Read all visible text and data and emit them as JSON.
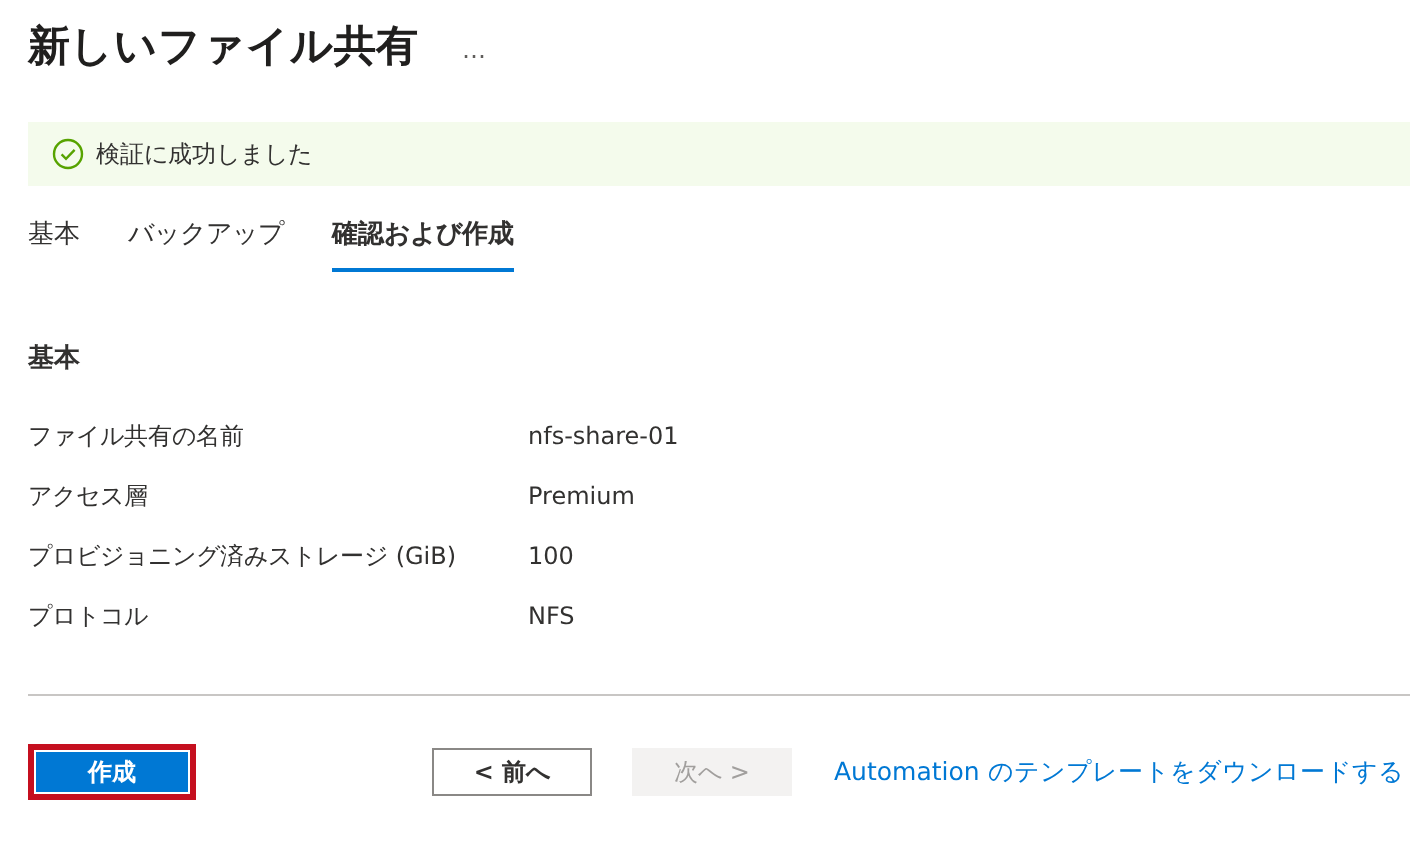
{
  "title": "新しいファイル共有",
  "more": "…",
  "banner": {
    "text": "検証に成功しました"
  },
  "tabs": [
    {
      "label": "基本",
      "selected": false
    },
    {
      "label": "バックアップ",
      "selected": false
    },
    {
      "label": "確認および作成",
      "selected": true
    }
  ],
  "section": "基本",
  "rows": [
    {
      "label": "ファイル共有の名前",
      "value": "nfs-share-01"
    },
    {
      "label": "アクセス層",
      "value": "Premium"
    },
    {
      "label": "プロビジョニング済みストレージ (GiB)",
      "value": "100"
    },
    {
      "label": "プロトコル",
      "value": "NFS"
    }
  ],
  "footer": {
    "create": {
      "label": "作成",
      "highlighted": true
    },
    "prev": {
      "label": "< 前へ",
      "disabled": false
    },
    "next": {
      "label": "次へ >",
      "disabled": true
    },
    "link": "Automation のテンプレートをダウンロードする"
  }
}
